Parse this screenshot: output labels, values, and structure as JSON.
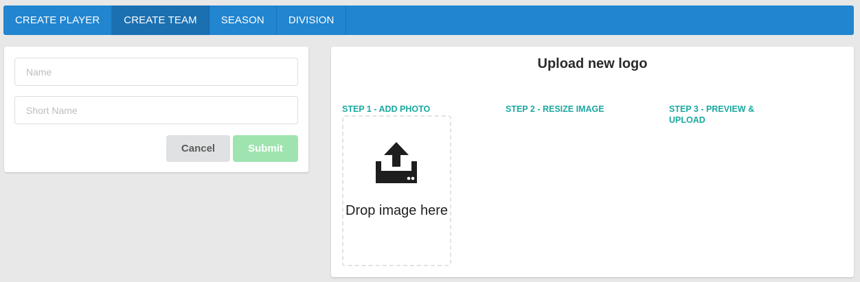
{
  "nav": {
    "items": [
      {
        "label": "CREATE PLAYER",
        "active": false
      },
      {
        "label": "CREATE TEAM",
        "active": true
      },
      {
        "label": "SEASON",
        "active": false
      },
      {
        "label": "DIVISION",
        "active": false
      }
    ]
  },
  "form": {
    "name_placeholder": "Name",
    "name_value": "",
    "short_name_placeholder": "Short Name",
    "short_name_value": "",
    "cancel_label": "Cancel",
    "submit_label": "Submit"
  },
  "upload": {
    "title": "Upload new logo",
    "step1": "STEP 1 - ADD PHOTO",
    "step2": "STEP 2 - RESIZE IMAGE",
    "step3": "STEP 3 - PREVIEW & UPLOAD",
    "drop_text": "Drop image here",
    "icon": "upload-icon"
  },
  "colors": {
    "nav_bg": "#2185d0",
    "nav_active": "#1b70b2",
    "step_text": "#1aa8a0",
    "submit_bg": "#9fe4b0",
    "cancel_bg": "#e0e1e2"
  }
}
